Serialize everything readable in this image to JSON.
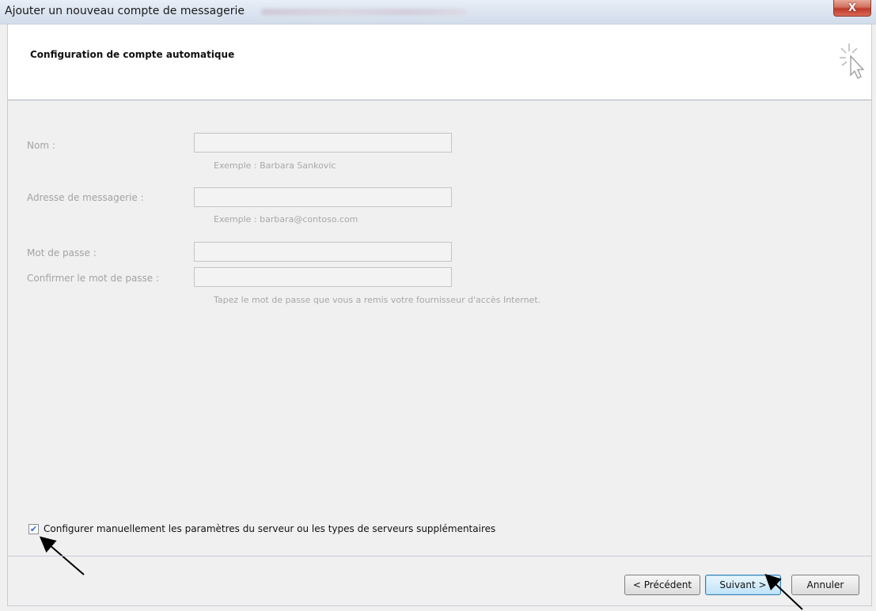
{
  "window": {
    "title": "Ajouter un nouveau compte de messagerie",
    "close_label": "X"
  },
  "header": {
    "heading": "Configuration de compte automatique"
  },
  "form": {
    "name_label": "Nom :",
    "name_value": "",
    "name_hint": "Exemple : Barbara Sankovic",
    "email_label": "Adresse de messagerie :",
    "email_value": "",
    "email_hint": "Exemple : barbara@contoso.com",
    "password_label": "Mot de passe :",
    "password_value": "",
    "confirm_label": "Confirmer le mot de passe :",
    "confirm_value": "",
    "password_hint": "Tapez le mot de passe que vous a remis votre fournisseur d'accès Internet."
  },
  "manual_config": {
    "checked": true,
    "label": "Configurer manuellement les paramètres du serveur ou les types de serveurs supplémentaires"
  },
  "buttons": {
    "back": "< Précédent",
    "next": "Suivant >",
    "cancel": "Annuler"
  }
}
